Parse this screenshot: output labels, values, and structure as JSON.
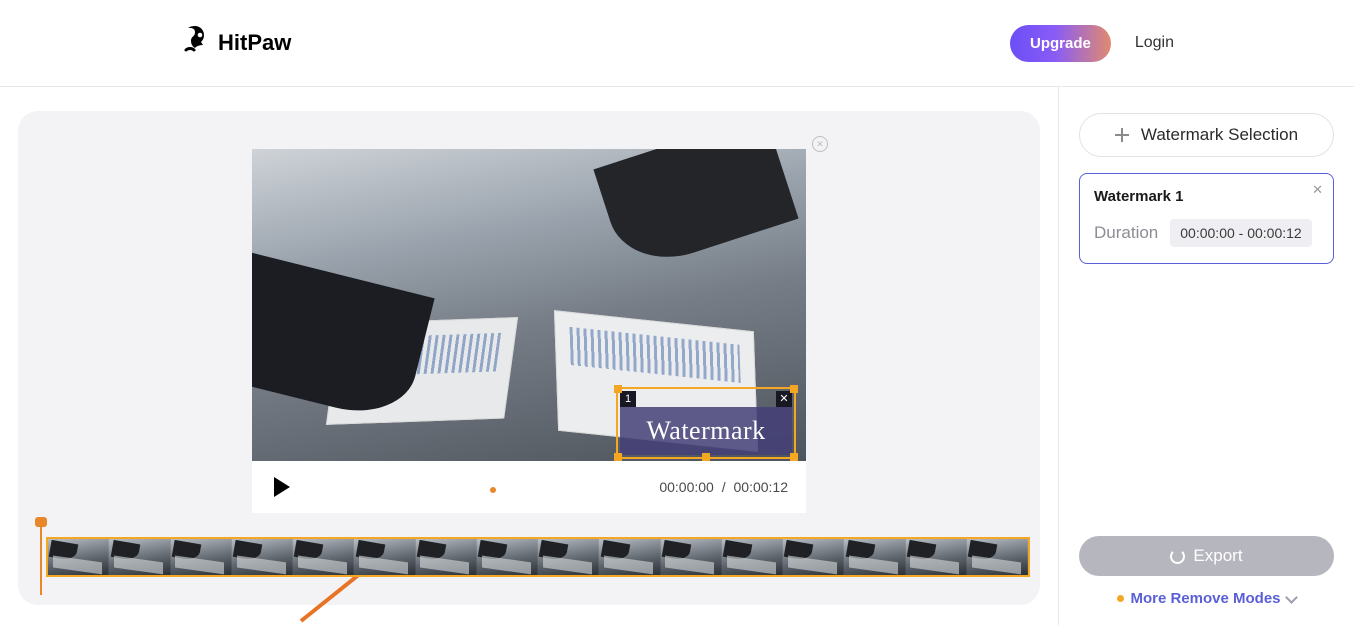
{
  "header": {
    "brand": "HitPaw",
    "upgrade": "Upgrade",
    "login": "Login"
  },
  "player": {
    "current_time": "00:00:00",
    "separator": "/",
    "total_time": "00:00:12",
    "watermark_box": {
      "index": "1",
      "label": "Watermark"
    }
  },
  "sidebar": {
    "add_button": "Watermark Selection",
    "watermark": {
      "title": "Watermark 1",
      "duration_label": "Duration",
      "duration_value": "00:00:00 - 00:00:12"
    },
    "export": "Export",
    "more_modes": "More Remove Modes"
  },
  "timeline": {
    "frame_count": 16
  }
}
